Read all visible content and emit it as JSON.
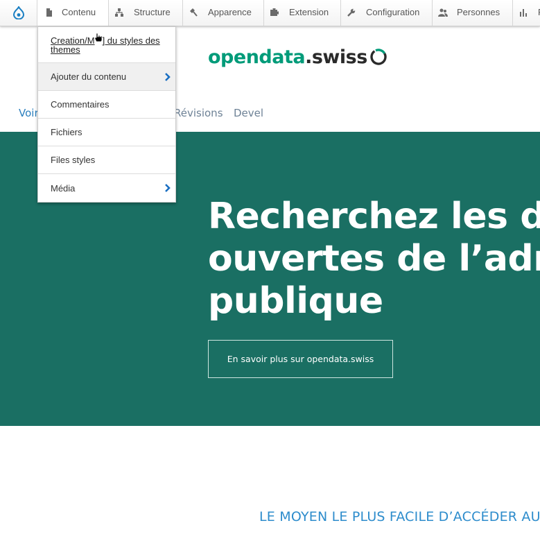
{
  "toolbar": {
    "home_icon": "drupal-drop-icon",
    "items": [
      {
        "label": "Contenu",
        "icon": "page-icon"
      },
      {
        "label": "Structure",
        "icon": "sitemap-icon"
      },
      {
        "label": "Apparence",
        "icon": "brush-icon"
      },
      {
        "label": "Extension",
        "icon": "puzzle-icon"
      },
      {
        "label": "Configuration",
        "icon": "wrench-icon"
      },
      {
        "label": "Personnes",
        "icon": "people-icon"
      },
      {
        "label": "R",
        "icon": "bar-chart-icon"
      }
    ]
  },
  "dropdown": {
    "items": [
      {
        "label": "Creation/M... du styles des themes",
        "line1": "Creation/M",
        "line1b": "] du styles des",
        "line2": "themes"
      },
      {
        "label": "Ajouter du contenu",
        "has_submenu": true
      },
      {
        "label": "Commentaires"
      },
      {
        "label": "Fichiers"
      },
      {
        "label": "Files styles"
      },
      {
        "label": "Média",
        "has_submenu": true
      }
    ]
  },
  "logo": {
    "part1": "opendata",
    "part2": ".swiss"
  },
  "tabs": {
    "view": "Voir",
    "revisions": "Révisions",
    "devel": "Devel"
  },
  "hero": {
    "title_line1": "Recherchez les données",
    "title_line2": "ouvertes de l’administration",
    "title_line3": "publique",
    "button": "En savoir plus sur opendata.swiss"
  },
  "subheading": "LE MOYEN LE PLUS FACILE D’ACCÉDER AUX",
  "colors": {
    "hero_bg": "#1a6f63",
    "brand_green": "#009b79",
    "link_blue": "#2a7fbe",
    "subhead_blue": "#2d8ccc"
  }
}
